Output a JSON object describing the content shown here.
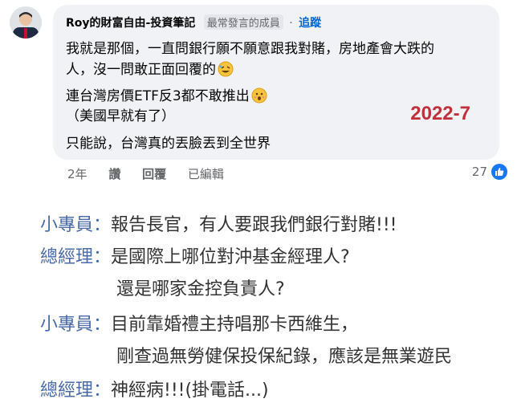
{
  "comment": {
    "author": "Roy的財富自由-投資筆記",
    "badge": "最常發言的成員",
    "separator": "·",
    "follow_label": "追蹤",
    "lines": [
      "我就是那個，一直問銀行願不願意跟我對賭，房地產會大跌的",
      "人，沒一問敢正面回覆的",
      "連台灣房價ETF反3都不敢推出",
      "（美國早就有了）",
      "只能說，台灣真的丟臉丟到全世界"
    ],
    "stamp": "2022-7",
    "emoji": [
      "rofl-emoji",
      "hushed-emoji"
    ]
  },
  "actions": {
    "time": "2年",
    "like": "讚",
    "reply": "回覆",
    "edited": "已編輯"
  },
  "reactions": {
    "count": "27",
    "icon": "thumbs-up-icon"
  },
  "dialog": [
    {
      "speaker": "小專員：",
      "text": "報告長官，有人要跟我們銀行對賭!!!"
    },
    {
      "speaker": "總經理：",
      "text": "是國際上哪位對沖基金經理人?"
    },
    {
      "speaker": "",
      "text": "還是哪家金控負責人?"
    },
    {
      "speaker": "小專員：",
      "text": "目前靠婚禮主持唱那卡西維生，"
    },
    {
      "speaker": "",
      "text": "剛查過無勞健保投保紀錄，應該是無業遊民"
    },
    {
      "speaker": "總經理：",
      "text": "神經病!!!(掛電話...)"
    }
  ],
  "colors": {
    "speaker": "#4a6aa8",
    "stamp": "#c0303a",
    "follow": "#0064d1",
    "bubble": "#f0f2f5"
  }
}
